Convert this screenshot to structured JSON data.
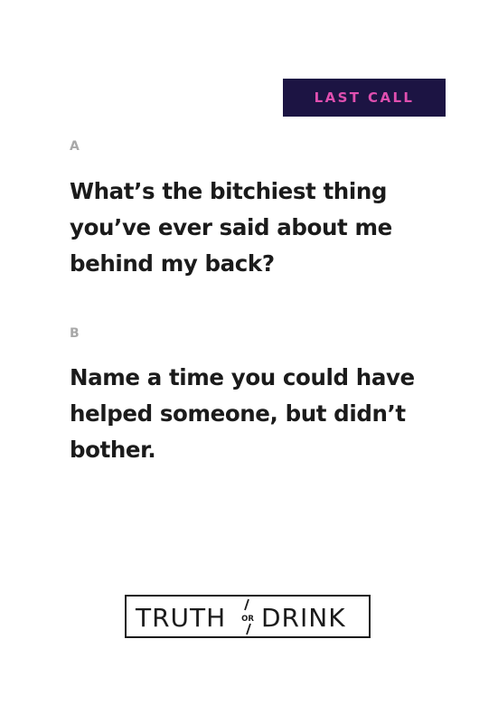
{
  "card": {
    "badge": {
      "label": "LAST CALL"
    },
    "options": [
      {
        "letter": "A",
        "question": "What’s the bitchiest thing you’ve ever said about me behind my back?"
      },
      {
        "letter": "B",
        "question": "Name a time you could have helped someone, but didn’t bother."
      }
    ],
    "logo": {
      "left": "TRUTH",
      "middle": "OR",
      "right": "DRINK"
    }
  },
  "colors": {
    "badge_background": "#1c1443",
    "badge_text": "#e04fb0",
    "letter_gray": "#a8a8a8",
    "text_dark": "#1b1b1b"
  }
}
